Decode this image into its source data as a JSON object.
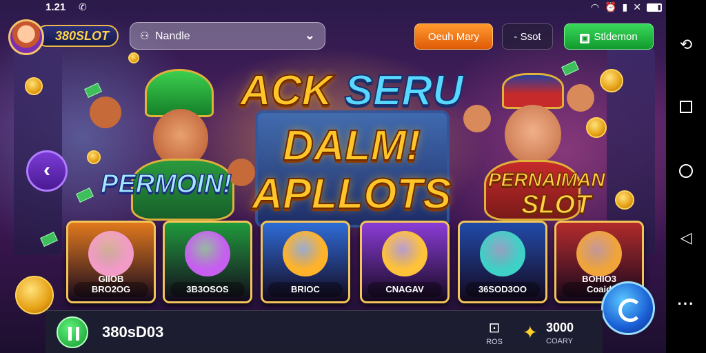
{
  "status_bar": {
    "time": "1.21",
    "left_icon": "whatsapp-icon",
    "right_icons": [
      "wifi-icon",
      "alarm-icon",
      "signal-icon",
      "volume-off-icon",
      "battery-icon"
    ]
  },
  "header": {
    "logo_text": "380SLOT",
    "search_value": "Nandle",
    "search_icon": "user-icon",
    "buttons": {
      "orange": "Oeuh Mary",
      "dark": "- Ssot",
      "green": "Stldemon"
    }
  },
  "hero": {
    "title_line1_a": "ACK ",
    "title_line1_b": "SERU",
    "title_line2": "DALM!",
    "title_line3": "APLLOTS",
    "left_label": "PERMOIN!",
    "right_label_1": "PERNAIMAN",
    "right_label_2": "SLOT"
  },
  "cards": [
    {
      "label1": "GIIOB",
      "label2": "BRO2OG",
      "bg": "#e0781c",
      "art": "#f29bc6"
    },
    {
      "label1": "",
      "label2": "3B3OSOS",
      "bg": "#1f9a3b",
      "art": "#c65ff0"
    },
    {
      "label1": "",
      "label2": "BRIOC",
      "bg": "#2d6cd6",
      "art": "#ffb32a"
    },
    {
      "label1": "",
      "label2": "CNAGAV",
      "bg": "#8a3cd6",
      "art": "#ffc23a"
    },
    {
      "label1": "",
      "label2": "36SOD3OO",
      "bg": "#1f4aa8",
      "art": "#3fd0c6"
    },
    {
      "label1": "BOHIO3",
      "label2": "Coaid",
      "bg": "#b22a2a",
      "art": "#f0a43a"
    }
  ],
  "bottom_bar": {
    "balance": "380sD03",
    "gift_label": "ROS",
    "coin_value": "3000",
    "coin_label": "COARY"
  },
  "colors": {
    "accent_orange": "#e05a07",
    "accent_green": "#129a2e",
    "gold": "#ffc629"
  }
}
